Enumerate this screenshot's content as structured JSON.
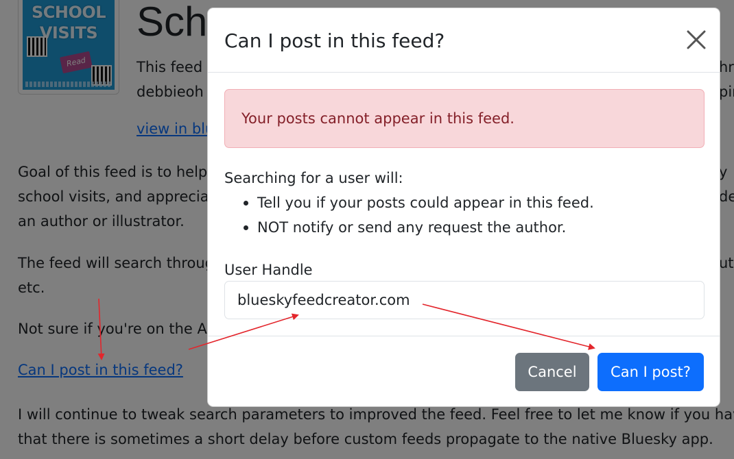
{
  "page": {
    "logo": {
      "line1": "SCHOOL",
      "line2": "VISITS",
      "book_label": "Read"
    },
    "title": "Scho",
    "desc_line1": "This feed",
    "desc_line1_right": "hra",
    "desc_line2": "debbieoh",
    "desc_line2_right": "pin",
    "view_link": "view in blu",
    "goal_line1": "Goal of this feed is to help",
    "goal_line1_right": "y",
    "goal_line2": "school visits, and apprecia",
    "goal_line2_right": "de",
    "goal_line3": "an author or illustrator.",
    "search_line1": "The feed will search throug",
    "search_line1_right": "ut",
    "search_line2": "etc.",
    "notsure": "Not sure if you're on the A",
    "can_post_link": "Can I post in this feed?",
    "tweak_line1": "I will continue to tweak search parameters to improved the feed. Feel free to let me know if you hav",
    "tweak_line2": "that there is sometimes a short delay before custom feeds propagate to the native Bluesky app."
  },
  "modal": {
    "title": "Can I post in this feed?",
    "alert": "Your posts cannot appear in this feed.",
    "lead": "Searching for a user will:",
    "bullets": [
      "Tell you if your posts could appear in this feed.",
      "NOT notify or send any request the author."
    ],
    "field_label": "User Handle",
    "handle_value": "blueskyfeedcreator.com",
    "cancel_label": "Cancel",
    "submit_label": "Can I post?"
  },
  "colors": {
    "primary": "#0d6efd",
    "secondary": "#6c757d",
    "alert_bg": "#f8d7da",
    "alert_text": "#842029",
    "annotation_arrow": "#e3262c"
  }
}
